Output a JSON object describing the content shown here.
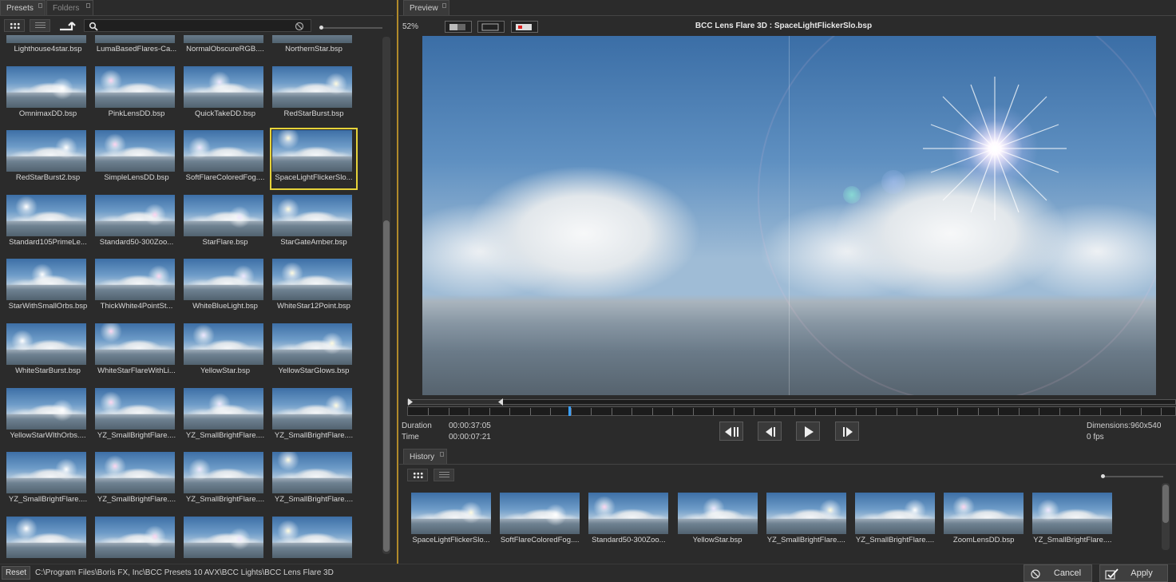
{
  "tabs_left": [
    {
      "label": "Presets",
      "active": true
    },
    {
      "label": "Folders",
      "active": false
    }
  ],
  "tab_preview": "Preview",
  "tab_history": "History",
  "presets": [
    "Lighthouse4star.bsp",
    "LumaBasedFlares-Ca...",
    "NormalObscureRGB....",
    "NorthernStar.bsp",
    "OmnimaxDD.bsp",
    "PinkLensDD.bsp",
    "QuickTakeDD.bsp",
    "RedStarBurst.bsp",
    "RedStarBurst2.bsp",
    "SimpleLensDD.bsp",
    "SoftFlareColoredFog....",
    "SpaceLightFlickerSlo...",
    "Standard105PrimeLe...",
    "Standard50-300Zoo...",
    "StarFlare.bsp",
    "StarGateAmber.bsp",
    "StarWithSmallOrbs.bsp",
    "ThickWhite4PointSt...",
    "WhiteBlueLight.bsp",
    "WhiteStar12Point.bsp",
    "WhiteStarBurst.bsp",
    "WhiteStarFlareWithLi...",
    "YellowStar.bsp",
    "YellowStarGlows.bsp",
    "YellowStarWIthOrbs....",
    "YZ_SmallBrightFlare....",
    "YZ_SmallBrightFlare....",
    "YZ_SmallBrightFlare....",
    "YZ_SmallBrightFlare....",
    "YZ_SmallBrightFlare....",
    "YZ_SmallBrightFlare....",
    "YZ_SmallBrightFlare....",
    "",
    "",
    "",
    ""
  ],
  "selected_preset": "SpaceLightFlickerSlo...",
  "preview": {
    "zoom": "52%",
    "title": "BCC Lens Flare 3D : SpaceLightFlickerSlo.bsp",
    "duration_label": "Duration",
    "duration": "00:00:37:05",
    "time_label": "Time",
    "time": "00:00:07:21",
    "dimensions": "Dimensions:960x540",
    "fps": "0 fps",
    "playhead_fraction": 0.21
  },
  "history": [
    "SpaceLightFlickerSlo...",
    "SoftFlareColoredFog....",
    "Standard50-300Zoo...",
    "YellowStar.bsp",
    "YZ_SmallBrightFlare....",
    "YZ_SmallBrightFlare....",
    "ZoomLensDD.bsp",
    "YZ_SmallBrightFlare...."
  ],
  "status": {
    "reset_label": "Reset",
    "path": "C:\\Program Files\\Boris FX, Inc\\BCC Presets 10 AVX\\BCC Lights\\BCC Lens Flare 3D",
    "cancel_label": "Cancel",
    "apply_label": "Apply"
  },
  "colors": {
    "selection": "#e6d33a",
    "divider": "#b08a2a",
    "playhead": "#3aa0ff"
  }
}
